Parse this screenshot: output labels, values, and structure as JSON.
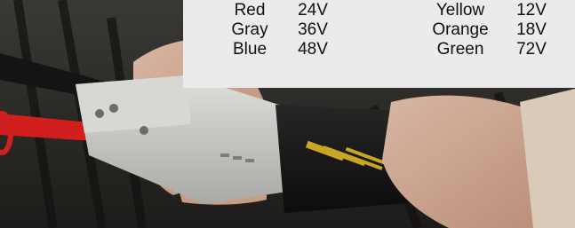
{
  "color_table": {
    "rows": [
      {
        "color_a": "Red",
        "voltage_a": "24V",
        "color_b": "Yellow",
        "voltage_b": "12V"
      },
      {
        "color_a": "Gray",
        "voltage_a": "36V",
        "color_b": "Orange",
        "voltage_b": "18V"
      },
      {
        "color_a": "Blue",
        "voltage_a": "48V",
        "color_b": "Green",
        "voltage_b": "72V"
      }
    ]
  },
  "photo": {
    "subject": "hands-holding-gray-connector-with-black-safety-shunt",
    "colors": {
      "background": "#2b2a28",
      "connector": "#c9c9c4",
      "shunt_body": "#161616",
      "shunt_label": "#c9a623",
      "red_cable": "#d01f1c",
      "skin": "#c9a28e",
      "table_bg": "#ebebeb"
    }
  }
}
